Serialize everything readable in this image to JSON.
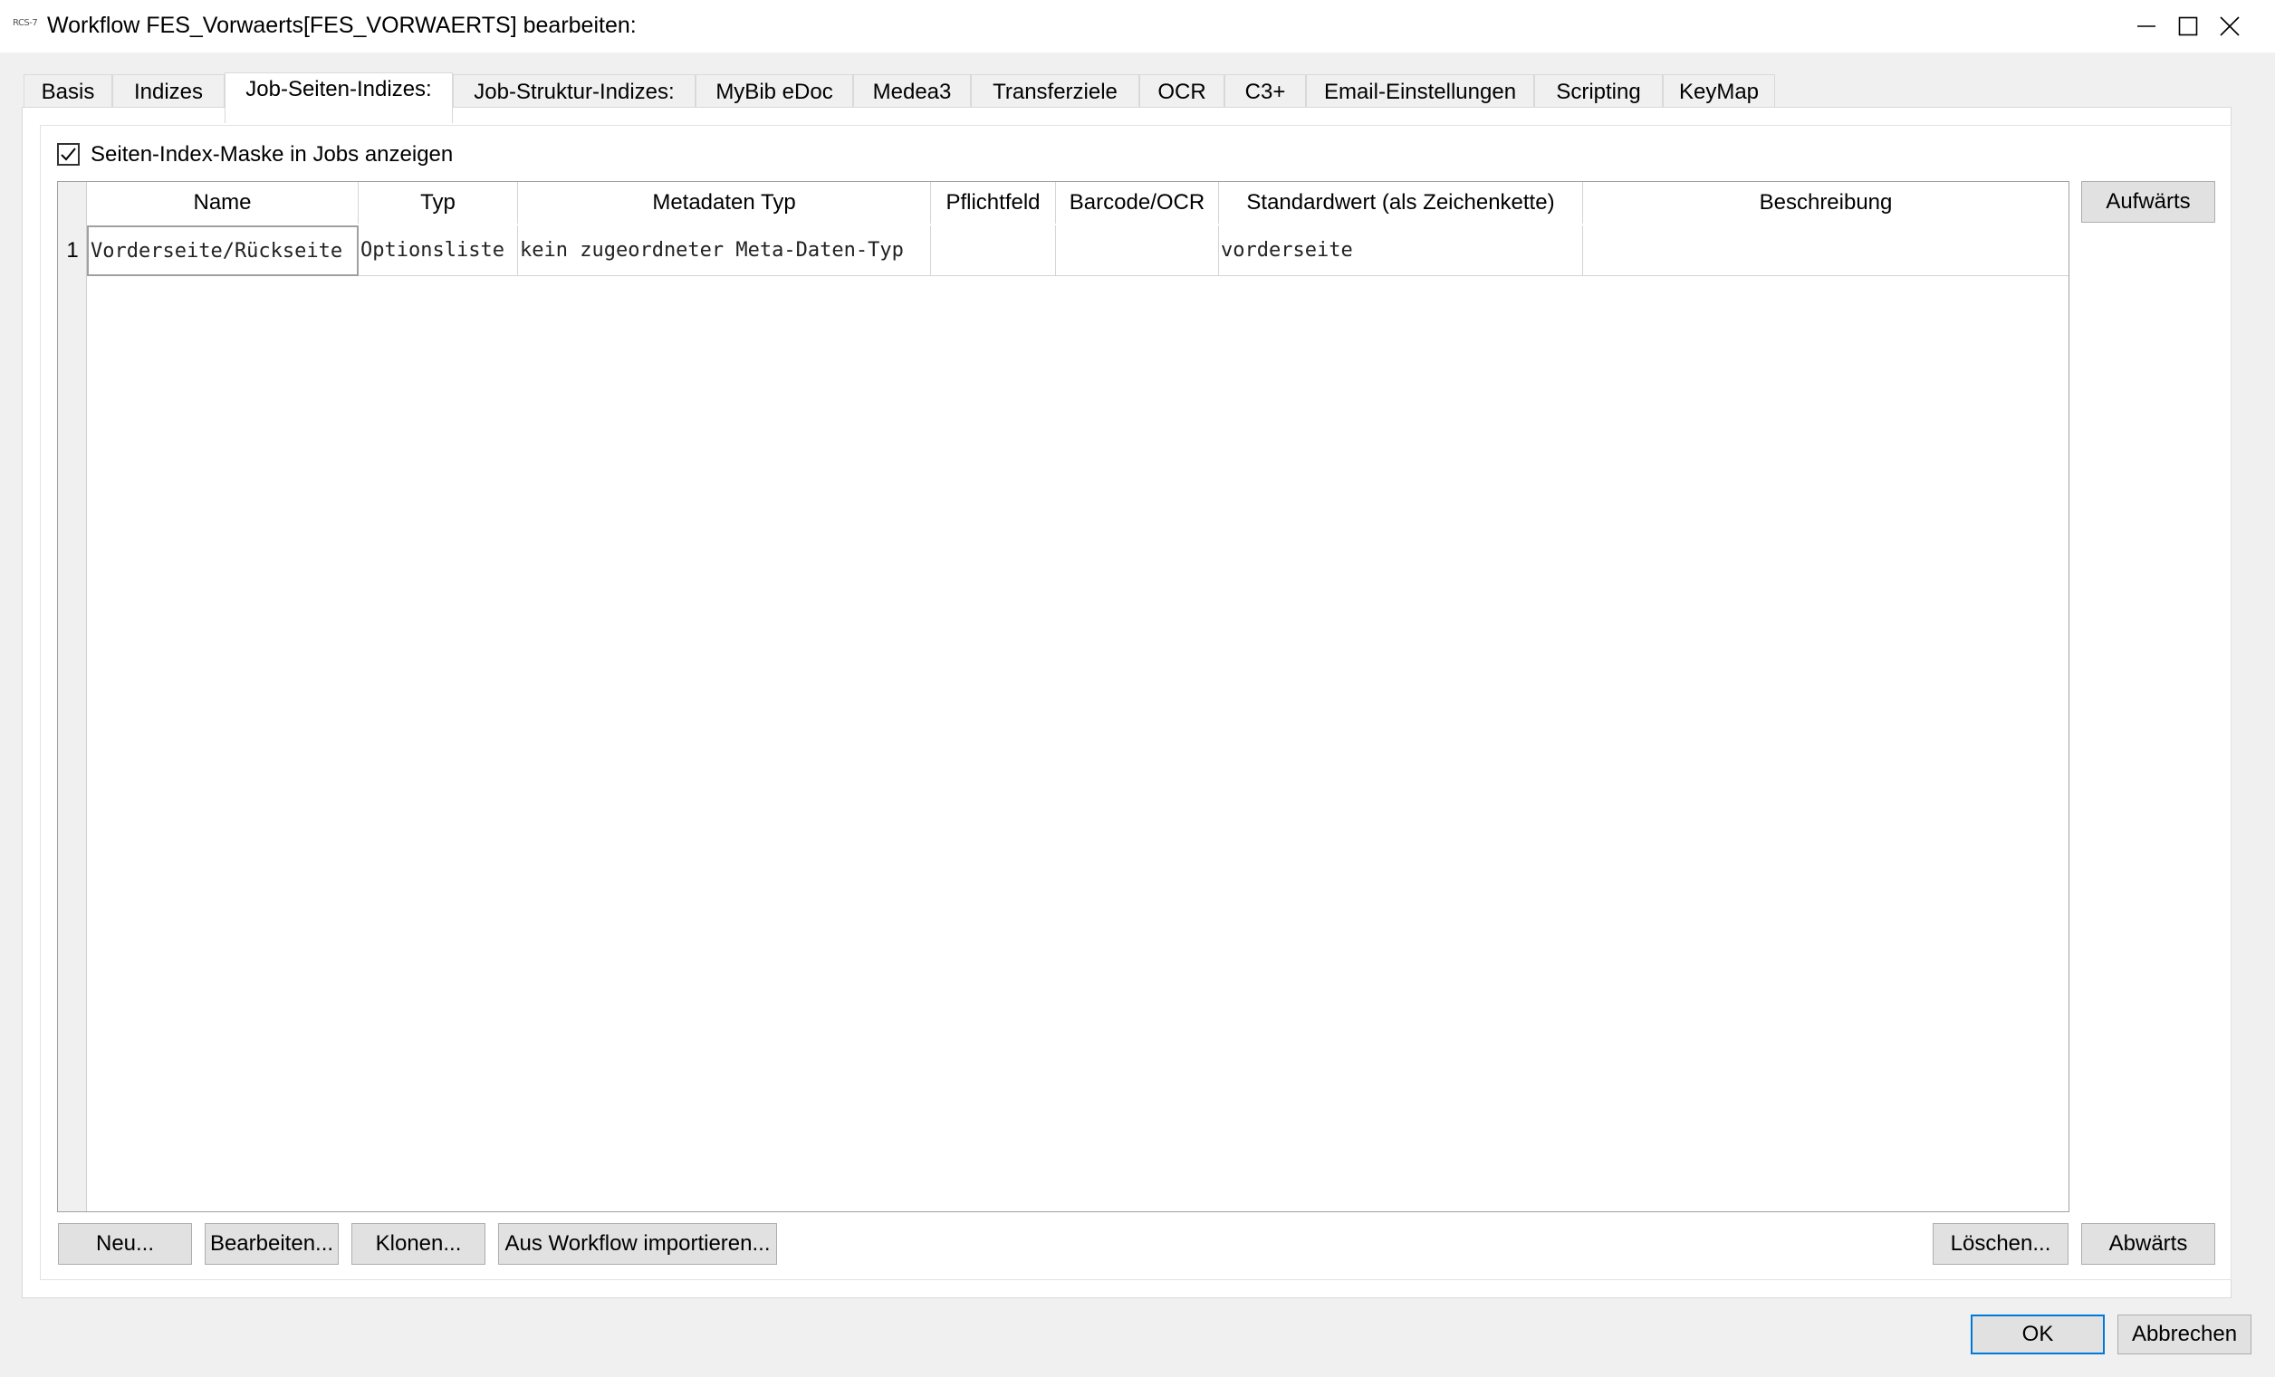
{
  "window": {
    "title": "Workflow FES_Vorwaerts[FES_VORWAERTS] bearbeiten:",
    "app_icon_text": "RCS-7"
  },
  "tabs": [
    {
      "label": "Basis",
      "active": false
    },
    {
      "label": "Indizes",
      "active": false
    },
    {
      "label": "Job-Seiten-Indizes:",
      "active": true
    },
    {
      "label": "Job-Struktur-Indizes:",
      "active": false
    },
    {
      "label": "MyBib eDoc",
      "active": false
    },
    {
      "label": "Medea3",
      "active": false
    },
    {
      "label": "Transferziele",
      "active": false
    },
    {
      "label": "OCR",
      "active": false
    },
    {
      "label": "C3+",
      "active": false
    },
    {
      "label": "Email-Einstellungen",
      "active": false
    },
    {
      "label": "Scripting",
      "active": false
    },
    {
      "label": "KeyMap",
      "active": false
    }
  ],
  "checkbox": {
    "label": "Seiten-Index-Maske in Jobs anzeigen",
    "checked": true
  },
  "table": {
    "columns": [
      "Name",
      "Typ",
      "Metadaten Typ",
      "Pflichtfeld",
      "Barcode/OCR",
      "Standardwert (als Zeichenkette)",
      "Beschreibung"
    ],
    "rows": [
      {
        "row_number": "1",
        "cells": [
          "Vorderseite/Rückseite",
          "Optionsliste",
          "kein zugeordneter Meta-Daten-Typ",
          "",
          "",
          "vorderseite",
          ""
        ]
      }
    ]
  },
  "buttons": {
    "up": "Aufwärts",
    "down": "Abwärts",
    "new": "Neu...",
    "edit": "Bearbeiten...",
    "clone": "Klonen...",
    "import": "Aus Workflow importieren...",
    "delete": "Löschen...",
    "ok": "OK",
    "cancel": "Abbrechen"
  },
  "colors": {
    "accent": "#0078d7",
    "window_bg": "#f0f0f0",
    "button_bg": "#e1e1e1"
  }
}
